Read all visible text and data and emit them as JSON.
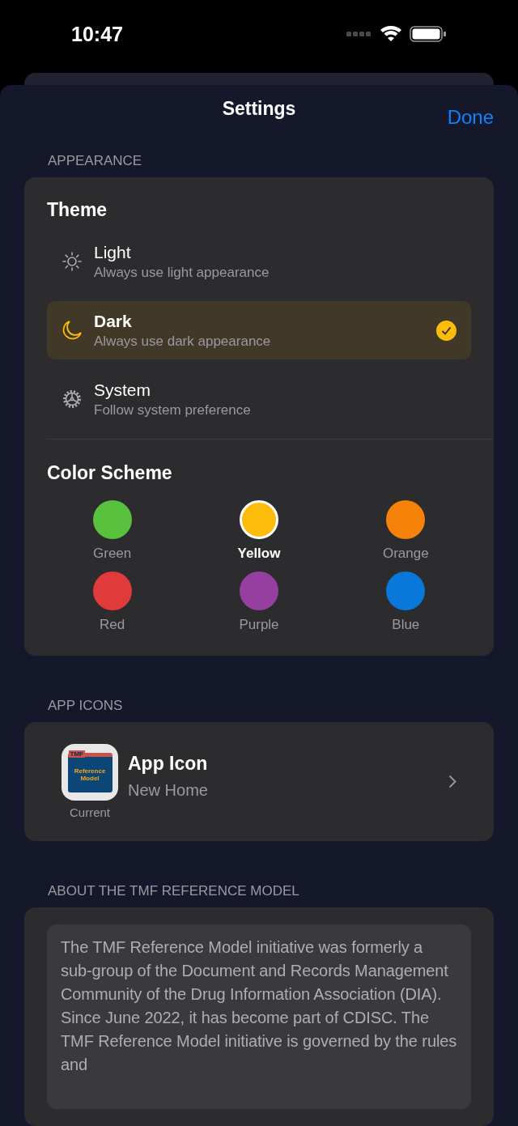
{
  "status_bar": {
    "time": "10:47"
  },
  "header": {
    "title": "Settings",
    "done": "Done"
  },
  "appearance": {
    "label": "APPEARANCE",
    "theme_title": "Theme",
    "themes": [
      {
        "kind": "light",
        "title": "Light",
        "subtitle": "Always use light appearance",
        "selected": false
      },
      {
        "kind": "dark",
        "title": "Dark",
        "subtitle": "Always use dark appearance",
        "selected": true
      },
      {
        "kind": "system",
        "title": "System",
        "subtitle": "Follow system preference",
        "selected": false
      }
    ],
    "scheme_title": "Color Scheme",
    "colors": [
      {
        "name": "Green",
        "color": "#5ac13f",
        "selected": false
      },
      {
        "name": "Yellow",
        "color": "#fdbb0a",
        "selected": true
      },
      {
        "name": "Orange",
        "color": "#f7820a",
        "selected": false
      },
      {
        "name": "Red",
        "color": "#e03a3a",
        "selected": false
      },
      {
        "name": "Purple",
        "color": "#973ea1",
        "selected": false
      },
      {
        "name": "Blue",
        "color": "#0a77db",
        "selected": false
      }
    ]
  },
  "app_icons": {
    "label": "APP ICONS",
    "icon_badge": "TMF",
    "icon_text": "Reference Model",
    "current": "Current",
    "title": "App Icon",
    "subtitle": "New Home"
  },
  "about": {
    "label": "ABOUT THE TMF REFERENCE MODEL",
    "text": "The TMF Reference Model initiative was formerly a sub-group of the Document and Records Management Community of the Drug Information Association (DIA). Since June 2022, it has become part of CDISC. The TMF Reference Model initiative is governed by the rules and"
  }
}
